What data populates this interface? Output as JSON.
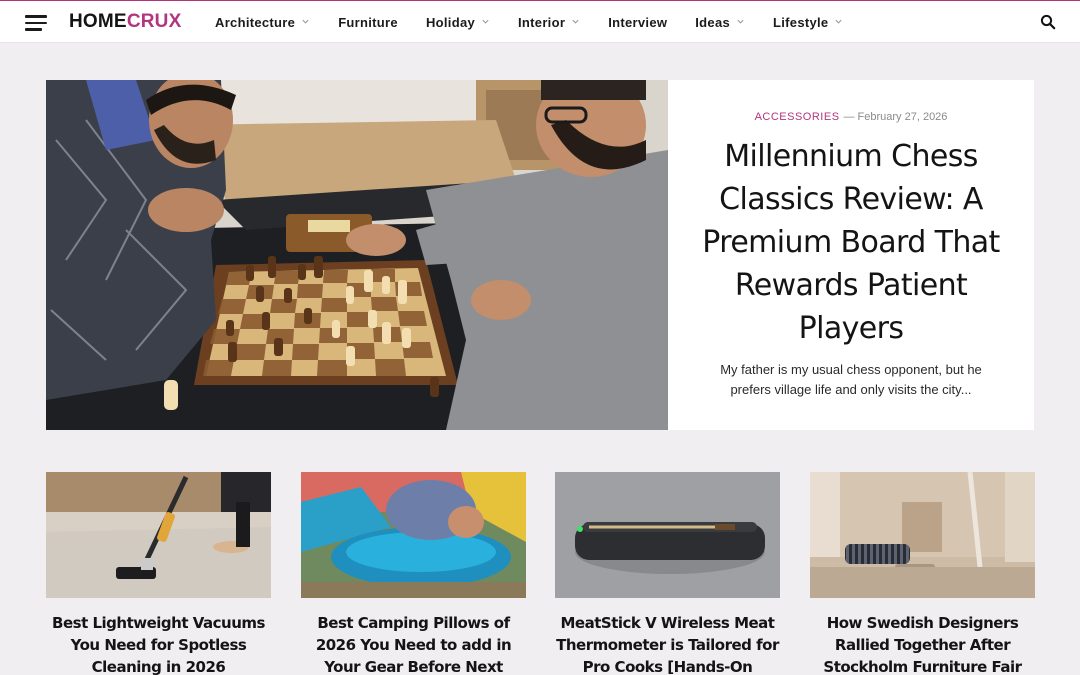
{
  "header": {
    "logo_part1": "HOME",
    "logo_part2": "CRUX",
    "menu_icon": "hamburger-menu-icon",
    "search_icon": "search-icon",
    "nav": [
      {
        "label": "Architecture",
        "has_dropdown": true
      },
      {
        "label": "Furniture",
        "has_dropdown": false
      },
      {
        "label": "Holiday",
        "has_dropdown": true
      },
      {
        "label": "Interior",
        "has_dropdown": true
      },
      {
        "label": "Interview",
        "has_dropdown": false
      },
      {
        "label": "Ideas",
        "has_dropdown": true
      },
      {
        "label": "Lifestyle",
        "has_dropdown": true
      }
    ]
  },
  "featured": {
    "category": "ACCESSORIES",
    "date": "February 27, 2026",
    "title": "Millennium Chess Classics Review: A Premium Board That Rewards Patient Players",
    "excerpt": "My father is my usual chess opponent, but he prefers village life and only visits the city..."
  },
  "cards": [
    {
      "title": "Best Lightweight Vacuums You Need for Spotless Cleaning in 2026"
    },
    {
      "title": "Best Camping Pillows of 2026 You Need to add in Your Gear Before Next Outing"
    },
    {
      "title": "MeatStick V Wireless Meat Thermometer is Tailored for Pro Cooks [Hands-On Review]"
    },
    {
      "title": "How Swedish Designers Rallied Together After Stockholm Furniture Fair Cancellation"
    }
  ],
  "colors": {
    "accent": "#b3347f",
    "background": "#f1eef1"
  }
}
